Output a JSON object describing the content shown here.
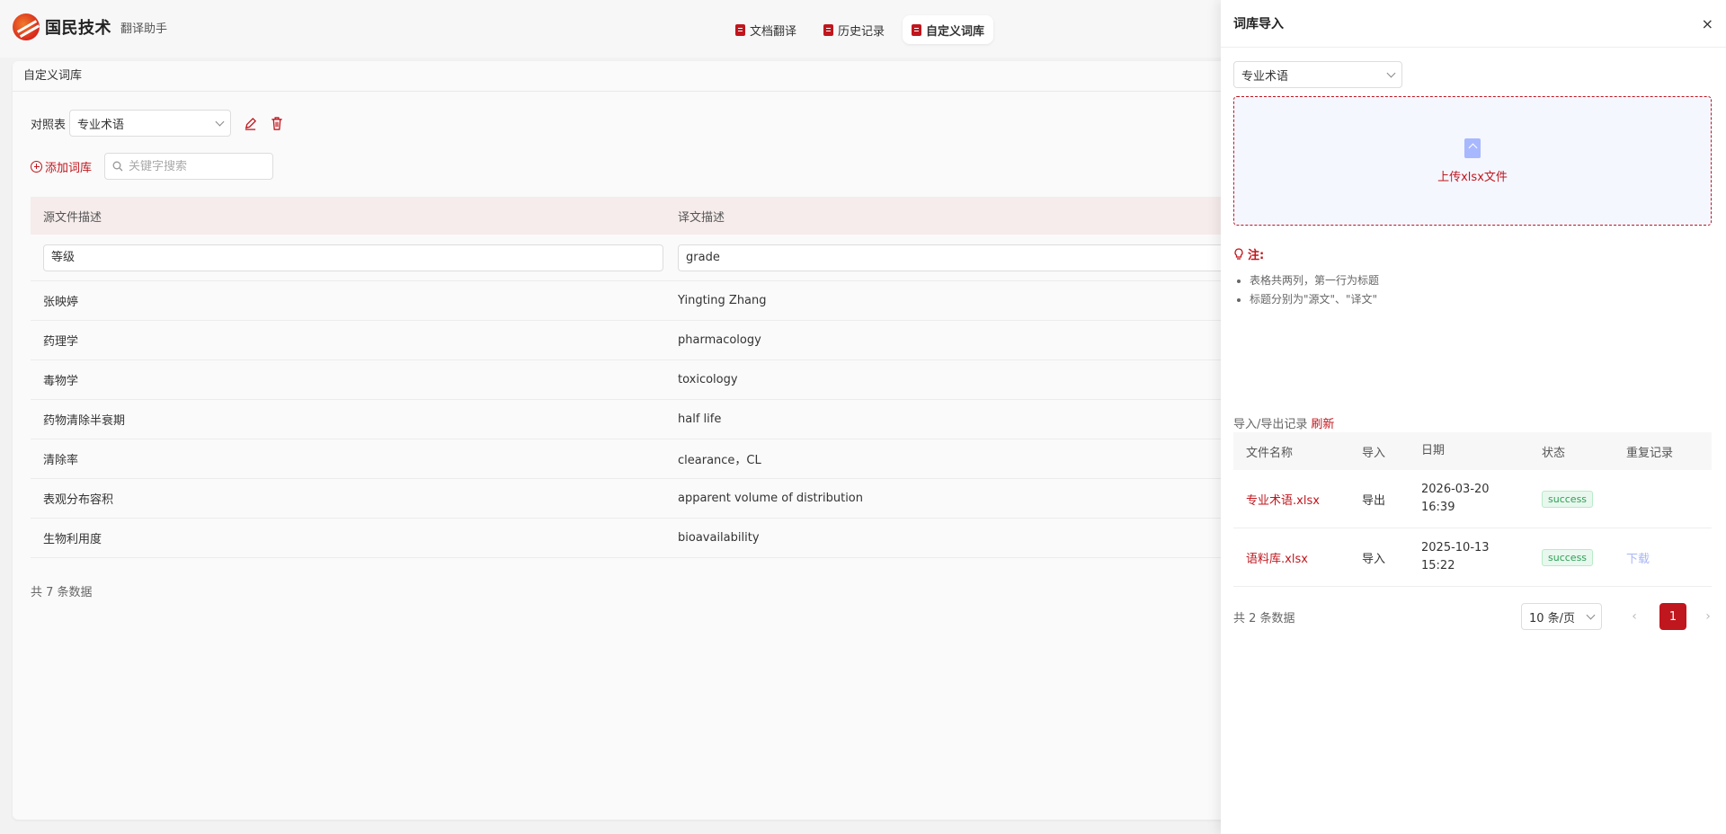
{
  "header": {
    "brand": "国民技术",
    "subtitle": "翻译助手",
    "tabs": [
      {
        "label": "文档翻译"
      },
      {
        "label": "历史记录"
      },
      {
        "label": "自定义词库"
      }
    ]
  },
  "main": {
    "title": "自定义词库",
    "table_label": "对照表",
    "table_select": "专业术语",
    "add_label": "添加词库",
    "search_placeholder": "关键字搜索",
    "columns": [
      "源文件描述",
      "译文描述"
    ],
    "edit_row": {
      "source": "等级",
      "target": "grade"
    },
    "rows": [
      {
        "source": "张映婷",
        "target": "Yingting Zhang"
      },
      {
        "source": "药理学",
        "target": "pharmacology"
      },
      {
        "source": "毒物学",
        "target": "toxicology"
      },
      {
        "source": "药物清除半衰期",
        "target": "half life"
      },
      {
        "source": "清除率",
        "target": "clearance，CL"
      },
      {
        "source": "表观分布容积",
        "target": "apparent volume of distribution"
      },
      {
        "source": "生物利用度",
        "target": "bioavailability"
      }
    ],
    "total": "共 7 条数据"
  },
  "drawer": {
    "title": "词库导入",
    "close": "×",
    "select": "专业术语",
    "upload_label": "上传xlsx文件",
    "note_title": "注:",
    "notes": [
      "表格共两列，第一行为标题",
      "标题分别为\"源文\"、\"译文\""
    ],
    "records_title": "导入/导出记录",
    "refresh": "刷新",
    "rec_columns": [
      "文件名称",
      "导入",
      "日期",
      "状态",
      "重复记录"
    ],
    "records": [
      {
        "name": "专业术语.xlsx",
        "type": "导出",
        "date": "2026-03-20",
        "time": "16:39",
        "status": "success",
        "dup": ""
      },
      {
        "name": "语料库.xlsx",
        "type": "导入",
        "date": "2025-10-13",
        "time": "15:22",
        "status": "success",
        "dup": "下载"
      }
    ],
    "total": "共 2 条数据",
    "page_size": "10 条/页",
    "current_page": "1",
    "prev": "‹",
    "next": "›"
  },
  "colors": {
    "accent": "#c0161d",
    "success": "#2e9e55",
    "link_muted": "#a9b6f5"
  }
}
